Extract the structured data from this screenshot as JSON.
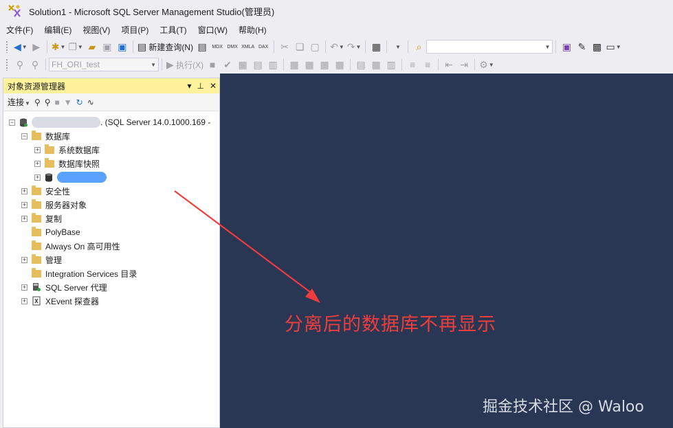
{
  "window": {
    "title": "Solution1 - Microsoft SQL Server Management Studio(管理员)"
  },
  "menu": [
    "文件(F)",
    "编辑(E)",
    "视图(V)",
    "项目(P)",
    "工具(T)",
    "窗口(W)",
    "帮助(H)"
  ],
  "toolbar1": {
    "new_query_label": "新建查询(N)",
    "query_types": [
      "MDX",
      "DMX",
      "XMLA",
      "DAX"
    ],
    "search_combo_value": ""
  },
  "toolbar2": {
    "database_combo": "FH_ORI_test",
    "execute_label": "执行(X)"
  },
  "object_explorer": {
    "title": "对象资源管理器",
    "connect_label": "连接",
    "server_suffix": ". (SQL Server 14.0.1000.169 -",
    "nodes": {
      "databases": "数据库",
      "system_databases": "系统数据库",
      "db_snapshots": "数据库快照",
      "security": "安全性",
      "server_objects": "服务器对象",
      "replication": "复制",
      "polybase": "PolyBase",
      "always_on": "Always On 高可用性",
      "management": "管理",
      "integration_services": "Integration Services 目录",
      "sql_agent": "SQL Server 代理",
      "xevent": "XEvent 探查器"
    }
  },
  "annotation": "分离后的数据库不再显示",
  "watermark": "掘金技术社区 @ Waloo",
  "colors": {
    "workspace": "#293754",
    "explorer_header": "#fff29d",
    "annotation": "#ee3d3d",
    "selection": "#59a2ff"
  }
}
